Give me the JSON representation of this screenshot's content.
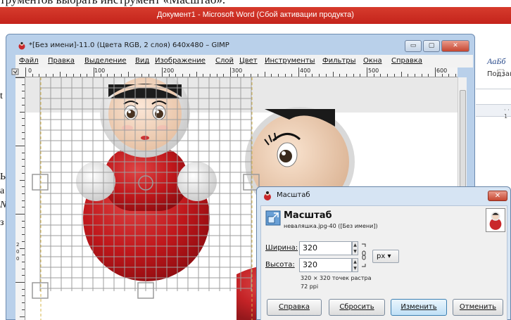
{
  "doc": {
    "top_text": "трументов выбрать инструмент «Масштаб».",
    "left_chars": [
      "t",
      "Ь",
      "а",
      "N",
      "з"
    ]
  },
  "word": {
    "title": "Документ1 - Microsoft Word (Сбой активации продукта)",
    "style_preview": "AaБб",
    "style_name": "Подзаг",
    "ruler_mark": "· · 1"
  },
  "gimp": {
    "title": "*[Без имени]-11.0 (Цвета RGB, 2 слоя) 640x480 – GIMP",
    "window_buttons": [
      "▭",
      "▢",
      "✕"
    ],
    "menu": [
      "Файл",
      "Правка",
      "Выделение",
      "Вид",
      "Изображение",
      "Слой",
      "Цвет",
      "Инструменты",
      "Фильтры",
      "Окна",
      "Справка"
    ],
    "ruler_h": [
      "0",
      "100",
      "200",
      "300",
      "400",
      "500",
      "600"
    ],
    "ruler_v": [
      "2",
      "0",
      "0"
    ]
  },
  "dialog": {
    "window_title": "Масштаб",
    "header_title": "Масштаб",
    "header_subtitle": "неваляшка.jpg-40 ([Без имени])",
    "width_label": "Ширина:",
    "width_value": "320",
    "height_label": "Высота:",
    "height_value": "320",
    "unit": "px",
    "info_size": "320 × 320 точек растра",
    "info_ppi": "72 ppi",
    "buttons": {
      "help": "Справка",
      "reset": "Сбросить",
      "change": "Изменить",
      "cancel": "Отменить"
    }
  }
}
